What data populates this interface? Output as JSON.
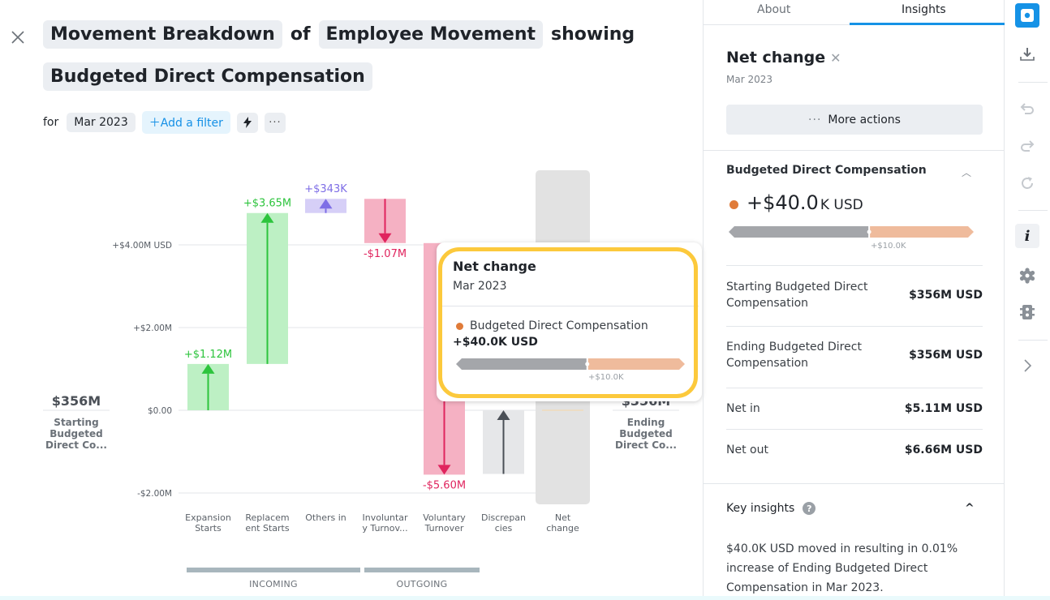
{
  "header": {
    "title_parts": [
      "Movement Breakdown",
      "of",
      "Employee Movement",
      "showing",
      "Budgeted Direct Compensation"
    ],
    "for_label": "for",
    "period_chip": "Mar 2023",
    "add_filter_label": "Add a filter",
    "add_filter_icon": "plus-icon",
    "quick_icon": "lightning-icon",
    "more_icon": "ellipsis-icon"
  },
  "chart_data": {
    "type": "waterfall",
    "title": "Movement Breakdown of Employee Movement showing Budgeted Direct Compensation",
    "ylabel": "USD",
    "y_ticks": [
      "+$4.00M USD",
      "+$2.00M",
      "$0.00",
      "-$2.00M"
    ],
    "y_tick_values": [
      4.0,
      2.0,
      0.0,
      -2.0
    ],
    "ylim": [
      -2.2,
      5.2
    ],
    "start": {
      "value_label": "$356M",
      "name": "Starting Budgeted Direct Co..."
    },
    "end": {
      "value_label": "$356M",
      "name": "Ending Budgeted Direct Co..."
    },
    "categories": [
      "Expansion Starts",
      "Replacement Starts",
      "Others in",
      "Involuntary Turnover",
      "Voluntary Turnover",
      "Discrepancies",
      "Net change"
    ],
    "category_display": [
      [
        "Expansion",
        "Starts"
      ],
      [
        "Replacem",
        "ent Starts"
      ],
      [
        "Others in"
      ],
      [
        "Involuntar",
        "y Turnov..."
      ],
      [
        "Voluntary",
        "Turnover"
      ],
      [
        "Discrepan",
        "cies"
      ],
      [
        "Net",
        "change"
      ]
    ],
    "values_millions": [
      1.12,
      3.65,
      0.343,
      -1.07,
      -5.6,
      1.54,
      0.04
    ],
    "value_labels": [
      "+$1.12M",
      "+$3.65M",
      "+$343K",
      "-$1.07M",
      "-$5.60M",
      "",
      ""
    ],
    "colors": [
      "#2dc43d",
      "#2dc43d",
      "#7e6ee6",
      "#e0245e",
      "#e0245e",
      "#4b5057",
      "#e0e0e0"
    ],
    "fill_colors": [
      "#bdf0c4",
      "#bdf0c4",
      "#d6cff7",
      "#f5b1c3",
      "#f5b1c3",
      "#e6e7e9",
      "#e2e2e2"
    ],
    "groups": [
      {
        "label": "INCOMING",
        "span": [
          0,
          2
        ]
      },
      {
        "label": "OUTGOING",
        "span": [
          3,
          4
        ]
      }
    ]
  },
  "tooltip": {
    "title": "Net change",
    "subtitle": "Mar 2023",
    "series_name": "Budgeted Direct Compensation",
    "series_color": "#e07b39",
    "value": "+$40.0K USD",
    "bar_label": "+$10.0K",
    "bar_fill_fraction": 0.57
  },
  "panel": {
    "tabs": [
      {
        "label": "About",
        "active": false
      },
      {
        "label": "Insights",
        "active": true
      }
    ],
    "title": "Net change",
    "subtitle": "Mar 2023",
    "more_actions_label": "More actions",
    "metric_section": {
      "heading": "Budgeted Direct Compensation",
      "value_main": "+$40.0",
      "value_unit": "K USD",
      "dot_color": "#e07b39",
      "bar_label": "+$10.0K",
      "bar_fill_fraction": 0.57
    },
    "rows": [
      {
        "label": "Starting Budgeted Direct Compensation",
        "value": "$356M USD"
      },
      {
        "label": "Ending Budgeted Direct Compensation",
        "value": "$356M USD"
      },
      {
        "label": "Net in",
        "value": "$5.11M USD"
      },
      {
        "label": "Net out",
        "value": "$6.66M USD"
      }
    ],
    "key_insights": {
      "heading": "Key insights",
      "help_icon": "?",
      "text": "$40.0K USD moved in resulting in 0.01% increase of Ending Budgeted Direct Compensation in Mar 2023."
    }
  },
  "toolbar": {
    "items": [
      "camera-icon",
      "download-icon",
      "undo-icon",
      "redo-icon",
      "refresh-icon",
      "info-icon",
      "settings-icon",
      "filter-panel-icon",
      "chevron-right-icon"
    ],
    "accent": "#1592e6"
  }
}
